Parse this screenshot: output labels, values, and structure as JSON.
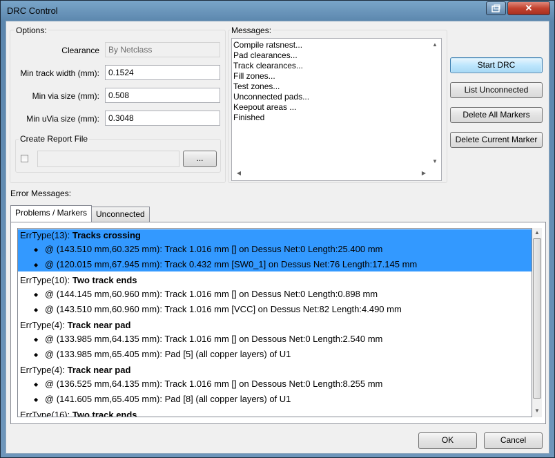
{
  "window": {
    "title": "DRC Control",
    "restore_icon": "restore-icon",
    "close_icon": "close-icon",
    "close_glyph": "✕"
  },
  "options": {
    "group_label": "Options:",
    "clearance_label": "Clearance",
    "clearance_value": "By Netclass",
    "min_track_label": "Min track width (mm):",
    "min_track_value": "0.1524",
    "min_via_label": "Min via size (mm):",
    "min_via_value": "0.508",
    "min_uvia_label": "Min uVia size (mm):",
    "min_uvia_value": "0.3048",
    "report": {
      "group_label": "Create Report File",
      "checked": false,
      "path_value": "",
      "browse_label": "..."
    }
  },
  "messages": {
    "label": "Messages:",
    "lines": [
      "Compile ratsnest...",
      "Pad clearances...",
      "Track clearances...",
      "Fill zones...",
      "Test zones...",
      "Unconnected pads...",
      "Keepout areas ...",
      "Finished"
    ]
  },
  "actions": {
    "start_drc": "Start DRC",
    "list_unconnected": "List Unconnected",
    "delete_all_markers": "Delete All Markers",
    "delete_current_marker": "Delete Current Marker"
  },
  "errors": {
    "label": "Error Messages:",
    "tabs": [
      "Problems / Markers",
      "Unconnected"
    ],
    "active_tab": "Problems / Markers",
    "selection_color": "#3399ff",
    "items": [
      {
        "prefix": "ErrType(13): ",
        "title": "Tracks crossing",
        "selected": true,
        "details": [
          "@ (143.510 mm,60.325 mm): Track 1.016 mm [] on Dessus Net:0 Length:25.400 mm",
          "@ (120.015 mm,67.945 mm): Track 0.432 mm [SW0_1] on Dessus Net:76 Length:17.145 mm"
        ]
      },
      {
        "prefix": "ErrType(10): ",
        "title": "Two track ends",
        "selected": false,
        "details": [
          "@ (144.145 mm,60.960 mm): Track 1.016 mm [] on Dessus Net:0 Length:0.898 mm",
          "@ (143.510 mm,60.960 mm): Track 1.016 mm [VCC] on Dessus Net:82 Length:4.490 mm"
        ]
      },
      {
        "prefix": "ErrType(4): ",
        "title": "Track near pad",
        "selected": false,
        "details": [
          "@ (133.985 mm,64.135 mm): Track 1.016 mm [] on Dessous Net:0 Length:2.540 mm",
          "@ (133.985 mm,65.405 mm): Pad [5] (all copper layers) of U1"
        ]
      },
      {
        "prefix": "ErrType(4): ",
        "title": "Track near pad",
        "selected": false,
        "details": [
          "@ (136.525 mm,64.135 mm): Track 1.016 mm [] on Dessous Net:0 Length:8.255 mm",
          "@ (141.605 mm,65.405 mm): Pad [8] (all copper layers) of U1"
        ]
      },
      {
        "prefix": "ErrType(16): ",
        "title": "Two track ends",
        "selected": false,
        "details": []
      }
    ]
  },
  "footer": {
    "ok": "OK",
    "cancel": "Cancel"
  }
}
